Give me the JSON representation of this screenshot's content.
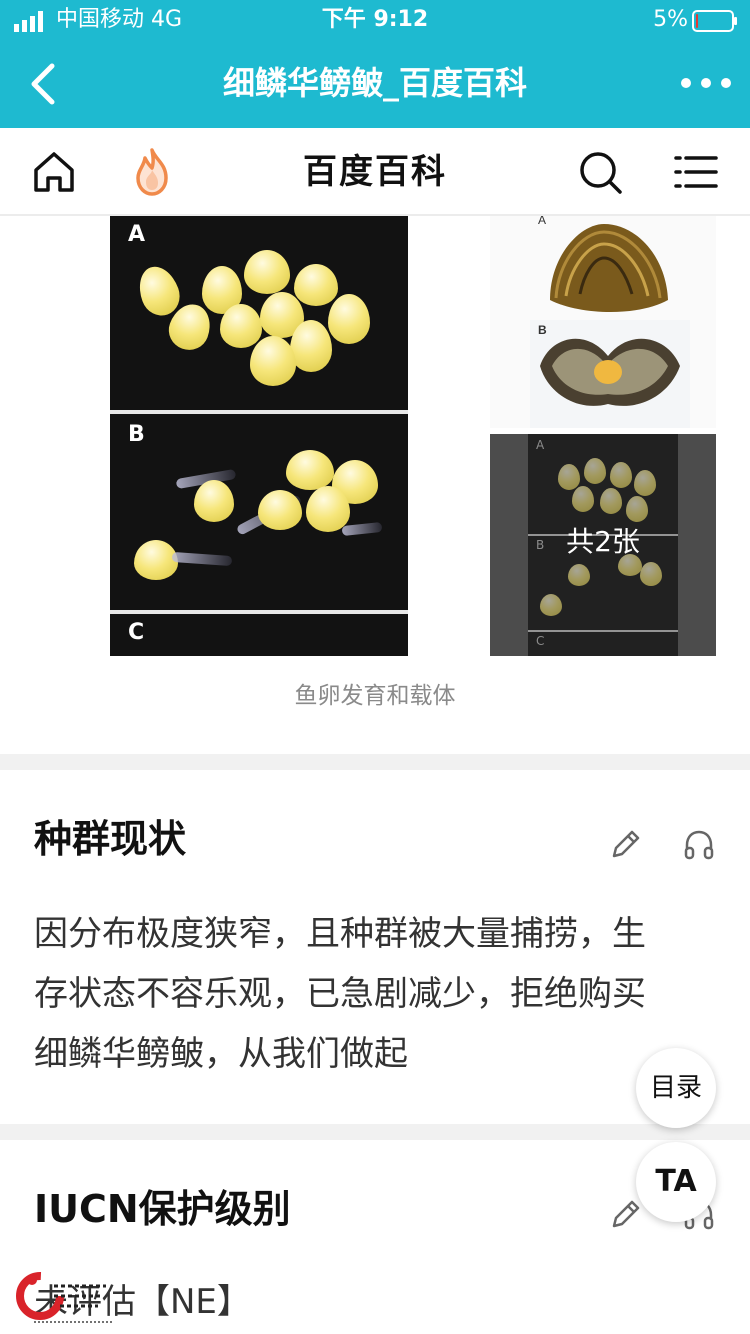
{
  "status_bar": {
    "carrier": "中国移动  4G",
    "time": "下午 9:12",
    "battery_percent": "5%",
    "battery_level": 0.05,
    "battery_color": "#e53935"
  },
  "title_bar": {
    "title": "细鳞华鳑鲏_百度百科",
    "background": "#1ebad0",
    "back_icon": "chevron-left-icon",
    "more_icon": "more-dots-icon"
  },
  "nav_bar": {
    "brand": "百度百科",
    "home_icon": "home-icon",
    "hot_icon": "flame-icon",
    "search_icon": "search-icon",
    "menu_icon": "list-menu-icon",
    "flame_color": "#f08a4b"
  },
  "gallery": {
    "main_panel_labels": [
      "A",
      "B",
      "C"
    ],
    "thumb_panel_labels": [
      "A",
      "B"
    ],
    "more_count_label": "共2张",
    "more_panel_labels": [
      "A",
      "B",
      "C"
    ],
    "caption": "鱼卵发育和载体"
  },
  "sections": [
    {
      "title": "种群现状",
      "edit_icon": "pencil-icon",
      "listen_icon": "headphones-icon",
      "lines": [
        "因分布极度狭窄，且种群被大量捕捞，生",
        "存状态不容乐观，已急剧减少，拒绝购买",
        "细鳞华鳑鲏，从我们做起"
      ]
    },
    {
      "title": "IUCN保护级别",
      "edit_icon": "pencil-icon",
      "listen_icon": "headphones-icon",
      "lines": [
        "未评估【NE】"
      ]
    }
  ],
  "floating": {
    "toc_label": "目录",
    "ta_label": "TA"
  }
}
